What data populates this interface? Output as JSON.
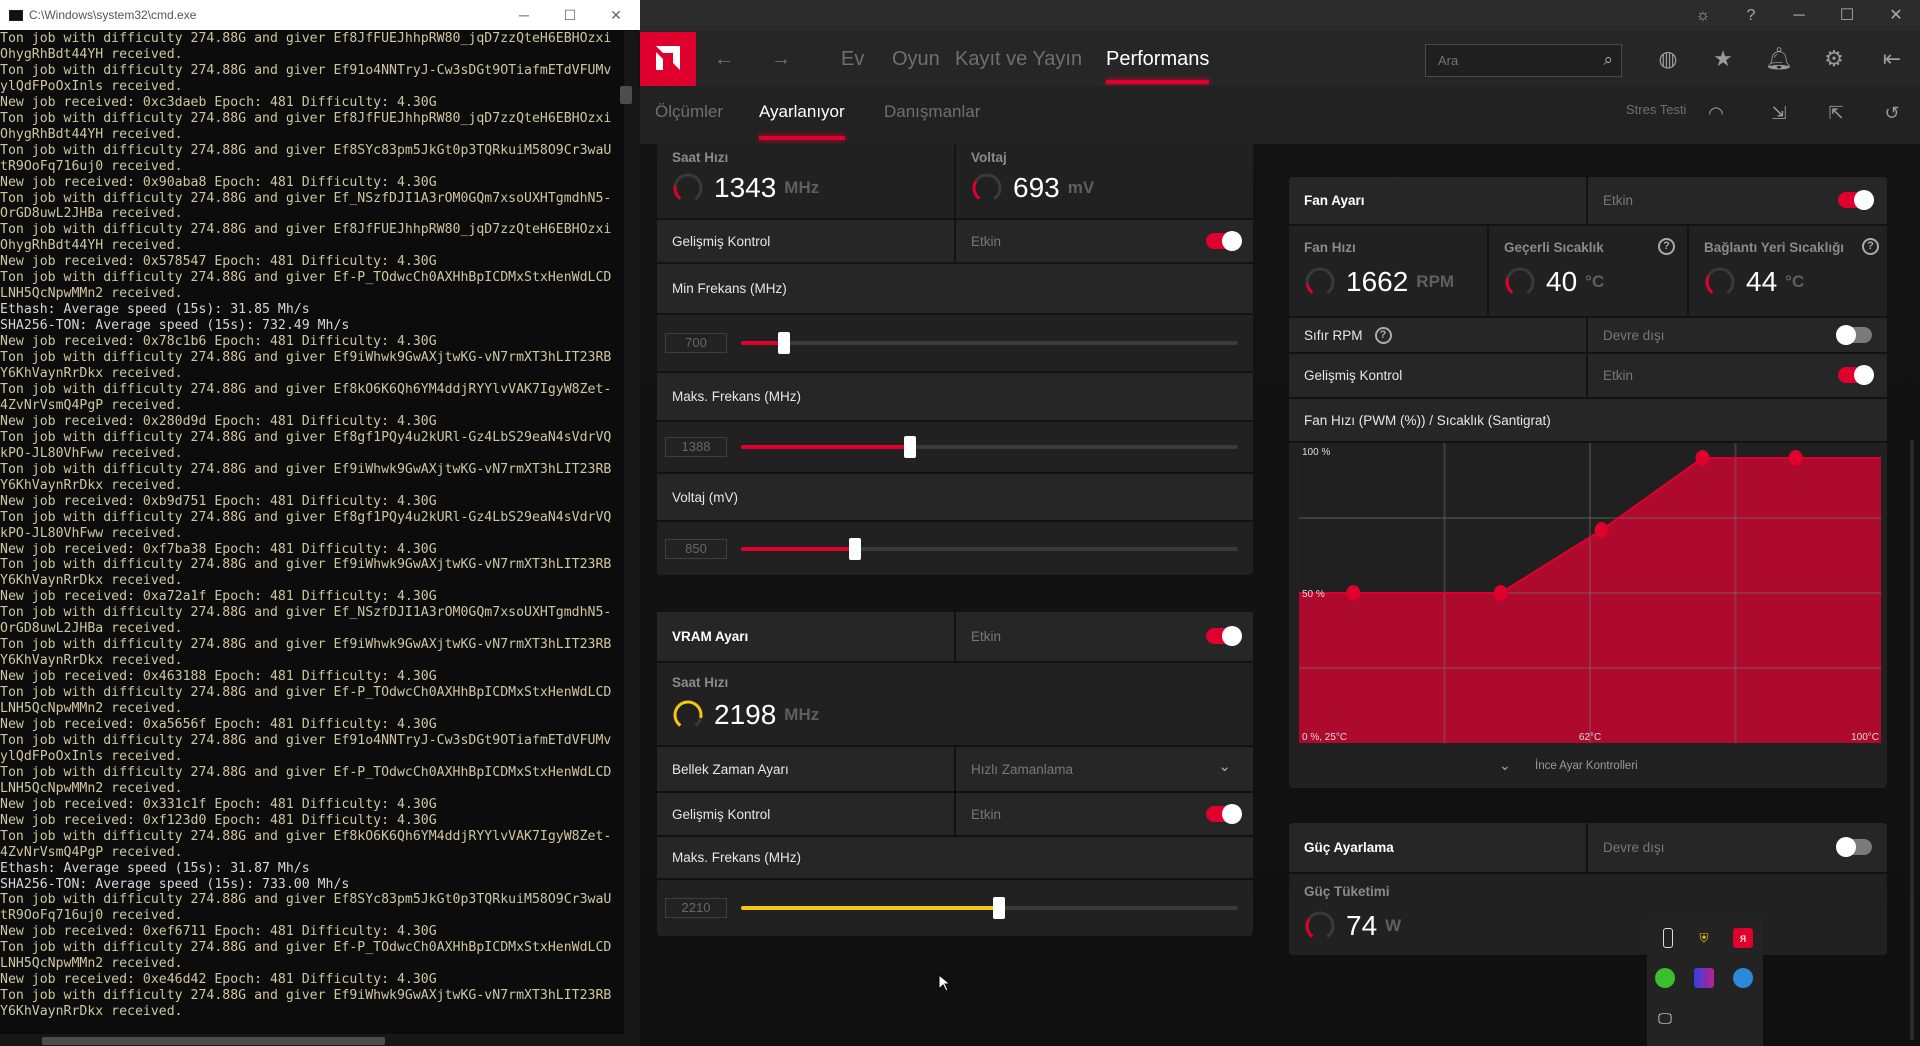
{
  "cmd": {
    "title": "C:\\Windows\\system32\\cmd.exe",
    "lines": [
      "Ton job with difficulty 274.88G and giver Ef8JfFUEJhhpRW80_jqD7zzQteH6EBHOzxi",
      "OhygRhBdt44YH received.",
      "Ton job with difficulty 274.88G and giver Ef91o4NNTryJ-Cw3sDGt9OTiafmETdVFUMv",
      "ylQdFPoOxInls received.",
      "New job received: 0xc3daeb Epoch: 481 Difficulty: 4.30G",
      "Ton job with difficulty 274.88G and giver Ef8JfFUEJhhpRW80_jqD7zzQteH6EBHOzxi",
      "OhygRhBdt44YH received.",
      "Ton job with difficulty 274.88G and giver Ef8SYc83pm5JkGt0p3TQRkuiM58O9Cr3waU",
      "tR9OoFq716uj0 received.",
      "New job received: 0x90aba8 Epoch: 481 Difficulty: 4.30G",
      "Ton job with difficulty 274.88G and giver Ef_NSzfDJI1A3rOM0GQm7xsoUXHTgmdhN5-",
      "OrGD8uwL2JHBa received.",
      "Ton job with difficulty 274.88G and giver Ef8JfFUEJhhpRW80_jqD7zzQteH6EBHOzxi",
      "OhygRhBdt44YH received.",
      "New job received: 0x578547 Epoch: 481 Difficulty: 4.30G",
      "Ton job with difficulty 274.88G and giver Ef-P_TOdwcCh0AXHhBpICDMxStxHenWdLCD",
      "LNH5QcNpwMMn2 received.",
      "Ethash: Average speed (15s): 31.85 Mh/s",
      "SHA256-TON: Average speed (15s): 732.49 Mh/s",
      "New job received: 0x78c1b6 Epoch: 481 Difficulty: 4.30G",
      "Ton job with difficulty 274.88G and giver Ef9iWhwk9GwAXjtwKG-vN7rmXT3hLIT23RB",
      "Y6KhVaynRrDkx received.",
      "Ton job with difficulty 274.88G and giver Ef8kO6K6Qh6YM4ddjRYYlvVAK7IgyW8Zet-",
      "4ZvNrVsmQ4PgP received.",
      "New job received: 0x280d9d Epoch: 481 Difficulty: 4.30G",
      "Ton job with difficulty 274.88G and giver Ef8gf1PQy4u2kURl-Gz4LbS29eaN4sVdrVQ",
      "kPO-JL80VhFww received.",
      "Ton job with difficulty 274.88G and giver Ef9iWhwk9GwAXjtwKG-vN7rmXT3hLIT23RB",
      "Y6KhVaynRrDkx received.",
      "New job received: 0xb9d751 Epoch: 481 Difficulty: 4.30G",
      "Ton job with difficulty 274.88G and giver Ef8gf1PQy4u2kURl-Gz4LbS29eaN4sVdrVQ",
      "kPO-JL80VhFww received.",
      "New job received: 0xf7ba38 Epoch: 481 Difficulty: 4.30G",
      "Ton job with difficulty 274.88G and giver Ef9iWhwk9GwAXjtwKG-vN7rmXT3hLIT23RB",
      "Y6KhVaynRrDkx received.",
      "New job received: 0xa72a1f Epoch: 481 Difficulty: 4.30G",
      "Ton job with difficulty 274.88G and giver Ef_NSzfDJI1A3rOM0GQm7xsoUXHTgmdhN5-",
      "OrGD8uwL2JHBa received.",
      "Ton job with difficulty 274.88G and giver Ef9iWhwk9GwAXjtwKG-vN7rmXT3hLIT23RB",
      "Y6KhVaynRrDkx received.",
      "New job received: 0x463188 Epoch: 481 Difficulty: 4.30G",
      "Ton job with difficulty 274.88G and giver Ef-P_TOdwcCh0AXHhBpICDMxStxHenWdLCD",
      "LNH5QcNpwMMn2 received.",
      "New job received: 0xa5656f Epoch: 481 Difficulty: 4.30G",
      "Ton job with difficulty 274.88G and giver Ef91o4NNTryJ-Cw3sDGt9OTiafmETdVFUMv",
      "ylQdFPoOxInls received.",
      "Ton job with difficulty 274.88G and giver Ef-P_TOdwcCh0AXHhBpICDMxStxHenWdLCD",
      "LNH5QcNpwMMn2 received.",
      "New job received: 0x331c1f Epoch: 481 Difficulty: 4.30G",
      "New job received: 0xf123d0 Epoch: 481 Difficulty: 4.30G",
      "Ton job with difficulty 274.88G and giver Ef8kO6K6Qh6YM4ddjRYYlvVAK7IgyW8Zet-",
      "4ZvNrVsmQ4PgP received.",
      "Ethash: Average speed (15s): 31.87 Mh/s",
      "SHA256-TON: Average speed (15s): 733.00 Mh/s",
      "Ton job with difficulty 274.88G and giver Ef8SYc83pm5JkGt0p3TQRkuiM58O9Cr3waU",
      "tR9OoFq716uj0 received.",
      "New job received: 0xef6711 Epoch: 481 Difficulty: 4.30G",
      "Ton job with difficulty 274.88G and giver Ef-P_TOdwcCh0AXHhBpICDMxStxHenWdLCD",
      "LNH5QcNpwMMn2 received.",
      "New job received: 0xe46d42 Epoch: 481 Difficulty: 4.30G",
      "Ton job with difficulty 274.88G and giver Ef9iWhwk9GwAXjtwKG-vN7rmXT3hLIT23RB",
      "Y6KhVaynRrDkx received."
    ]
  },
  "amd": {
    "accent": "#e0002d",
    "vram_accent": "#f5c518",
    "nav": {
      "back": "←",
      "forward": "→",
      "items": [
        "Ev",
        "Oyun",
        "Kayıt ve Yayın",
        "Performans"
      ],
      "active": "Performans"
    },
    "search_placeholder": "Ara",
    "subnav": {
      "items": [
        "Ölçümler",
        "Ayarlanıyor",
        "Danışmanlar"
      ],
      "active": "Ayarlanıyor",
      "stress_test": "Stres Testi"
    },
    "gpu": {
      "clock_label": "Saat Hızı",
      "clock_value": "1343",
      "clock_unit": "MHz",
      "clock_gauge": 0.22,
      "voltage_label": "Voltaj",
      "voltage_value": "693",
      "voltage_unit": "mV",
      "voltage_gauge": 0.3,
      "advanced_label": "Gelişmiş Kontrol",
      "advanced_state": "Etkin",
      "advanced_on": true,
      "sliders": [
        {
          "label": "Min Frekans (MHz)",
          "value": "700",
          "level": 0.087
        },
        {
          "label": "Maks. Frekans (MHz)",
          "value": "1388",
          "level": 0.34
        },
        {
          "label": "Voltaj (mV)",
          "value": "850",
          "level": 0.23
        }
      ]
    },
    "vram": {
      "title": "VRAM Ayarı",
      "state": "Etkin",
      "on": true,
      "clock_label": "Saat Hızı",
      "clock_value": "2198",
      "clock_unit": "MHz",
      "clock_gauge": 0.85,
      "timing_label": "Bellek Zaman Ayarı",
      "timing_value": "Hızlı Zamanlama",
      "advanced_label": "Gelişmiş Kontrol",
      "advanced_state": "Etkin",
      "advanced_on": true,
      "slider": {
        "label": "Maks. Frekans (MHz)",
        "value": "2210",
        "level": 0.52
      }
    },
    "fan": {
      "title": "Fan Ayarı",
      "state": "Etkin",
      "on": true,
      "speed_label": "Fan Hızı",
      "speed_value": "1662",
      "speed_unit": "RPM",
      "speed_gauge": 0.15,
      "temp_label": "Geçerli Sıcaklık",
      "temp_value": "40",
      "temp_unit": "°C",
      "temp_gauge": 0.25,
      "junction_label": "Bağlantı Yeri Sıcaklığı",
      "junction_value": "44",
      "junction_unit": "°C",
      "junction_gauge": 0.28,
      "zero_rpm_label": "Sıfır RPM",
      "zero_rpm_state": "Devre dışı",
      "zero_rpm_on": false,
      "advanced_label": "Gelişmiş Kontrol",
      "advanced_state": "Etkin",
      "advanced_on": true,
      "curve_title": "Fan Hızı (PWM (%)) / Sıcaklık (Santigrat)",
      "fine_tune": "İnce Ayar Kontrolleri"
    },
    "power": {
      "title": "Güç Ayarlama",
      "state": "Devre dışı",
      "on": false,
      "consumption_label": "Güç Tüketimi",
      "consumption_value": "74",
      "consumption_unit": "W",
      "consumption_gauge": 0.3
    }
  },
  "chart_data": {
    "type": "area",
    "title": "Fan Hızı (PWM (%)) / Sıcaklık (Santigrat)",
    "x": [
      32,
      51,
      64,
      77,
      89
    ],
    "y": [
      50,
      50,
      71,
      95,
      95
    ],
    "xlim": [
      25,
      100
    ],
    "ylim": [
      0,
      100
    ],
    "tick_labels": {
      "y_top": "100 %",
      "y_mid": "50 %",
      "origin": "0 %, 25°C",
      "x_mid": "62°C",
      "x_max": "100°C"
    },
    "grid": true,
    "color": "#e0002d"
  },
  "tray": {
    "icons": [
      "usb-eject-icon",
      "security-warning-icon",
      "amd-icon",
      "razer-icon",
      "app-icon",
      "chat-icon",
      "network-icon"
    ]
  }
}
